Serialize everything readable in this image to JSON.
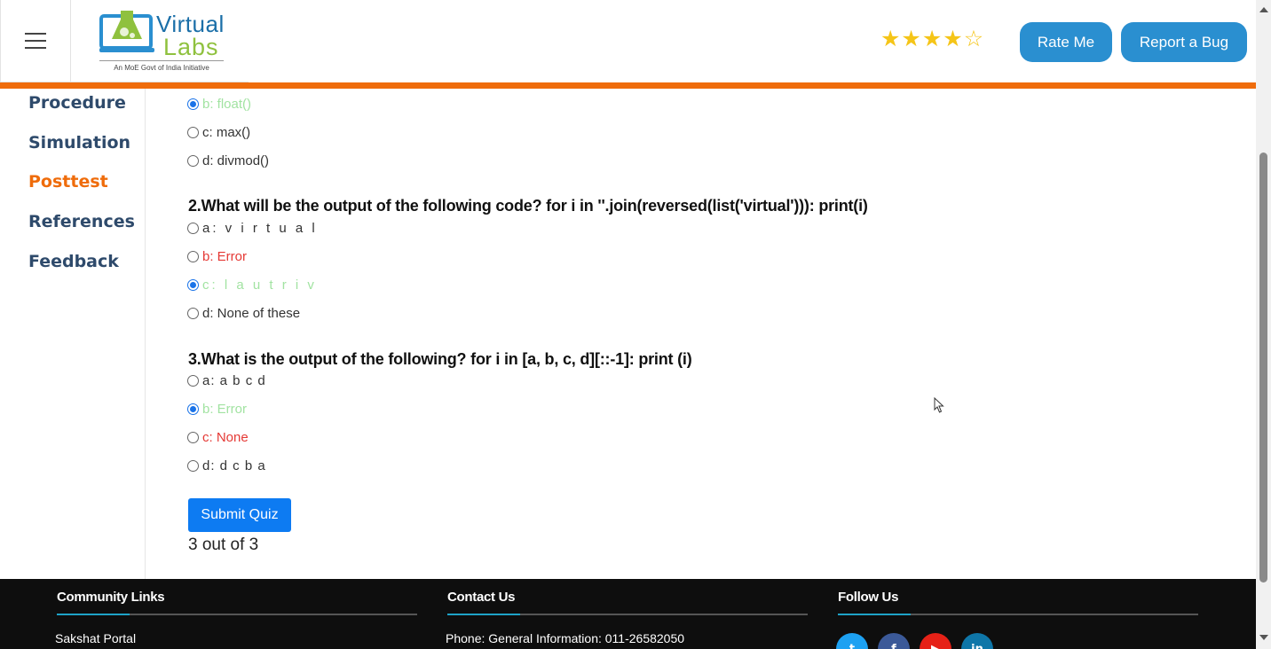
{
  "header": {
    "logo_word1": "Virtual",
    "logo_word2": "Labs",
    "logo_tagline": "An MoE Govt of India Initiative",
    "rating_stars": 4,
    "rating_max": 5,
    "rate_button": "Rate Me",
    "bug_button": "Report a Bug",
    "accent_color": "#ef6c0b",
    "button_color": "#2a8fd0"
  },
  "sidebar": {
    "items": [
      {
        "label": "Procedure",
        "active": false
      },
      {
        "label": "Simulation",
        "active": false
      },
      {
        "label": "Posttest",
        "active": true
      },
      {
        "label": "References",
        "active": false
      },
      {
        "label": "Feedback",
        "active": false
      }
    ]
  },
  "quiz": {
    "q1_options": [
      {
        "label": "b: float()",
        "state": "correct",
        "checked": true
      },
      {
        "label": "c: max()",
        "state": "normal",
        "checked": false
      },
      {
        "label": "d: divmod()",
        "state": "normal",
        "checked": false
      }
    ],
    "q2": {
      "text": "2.What will be the output of the following code? for i in ''.join(reversed(list('virtual'))): print(i)",
      "options": [
        {
          "label": "a: v i r t u a l",
          "state": "normal",
          "checked": false
        },
        {
          "label": "b: Error",
          "state": "wrong",
          "checked": false
        },
        {
          "label": "c: l a u t r i v",
          "state": "correct",
          "checked": true
        },
        {
          "label": "d: None of these",
          "state": "normal",
          "checked": false
        }
      ]
    },
    "q3": {
      "text": "3.What is the output of the following? for i in [a, b, c, d][::-1]: print (i)",
      "options": [
        {
          "label": "a: a b c d",
          "state": "normal",
          "checked": false
        },
        {
          "label": "b: Error",
          "state": "correct",
          "checked": true
        },
        {
          "label": "c: None",
          "state": "wrong",
          "checked": false
        },
        {
          "label": "d: d c b a",
          "state": "normal",
          "checked": false
        }
      ]
    },
    "submit_label": "Submit Quiz",
    "score_text": "3 out of 3"
  },
  "footer": {
    "community_heading": "Community Links",
    "community_item": "Sakshat Portal",
    "contact_heading": "Contact Us",
    "contact_item": "Phone: General Information: 011-26582050",
    "follow_heading": "Follow Us",
    "social": [
      {
        "icon": "twitter-icon",
        "color": "#1da1f2"
      },
      {
        "icon": "facebook-icon",
        "color": "#3b5998"
      },
      {
        "icon": "youtube-icon",
        "color": "#e62117"
      },
      {
        "icon": "linkedin-icon",
        "color": "#0e76a8"
      }
    ]
  }
}
